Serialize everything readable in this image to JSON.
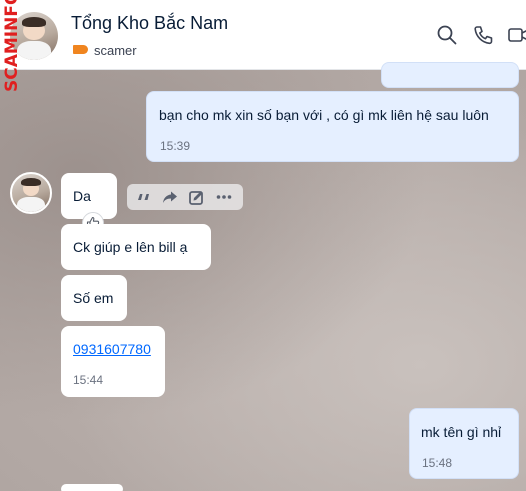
{
  "header": {
    "title": "Tổng Kho Bắc Nam",
    "tag_label": "scamer",
    "icons": [
      "search-icon",
      "phone-icon",
      "video-call-icon"
    ]
  },
  "watermark": {
    "text": "SCAMINFO"
  },
  "messages": [
    {
      "sender": "me",
      "text": "bạn cho mk xin số bạn với , có gì mk liên hệ sau luôn",
      "time": "15:39"
    },
    {
      "sender": "contact",
      "text": "Da"
    },
    {
      "sender": "contact",
      "text": "Ck giúp e lên bill ạ"
    },
    {
      "sender": "contact",
      "text": "Số em"
    },
    {
      "sender": "contact",
      "text": "0931607780",
      "time": "15:44"
    },
    {
      "sender": "me",
      "text": "mk tên gì nhỉ",
      "time": "15:48"
    }
  ],
  "message_actions": [
    "quote-icon",
    "forward-icon",
    "edit-icon",
    "more-icon"
  ],
  "colors": {
    "tag": "#f0851f",
    "my_bubble": "#e5efff",
    "link": "#0068ff",
    "watermark": "#e01f1f"
  }
}
